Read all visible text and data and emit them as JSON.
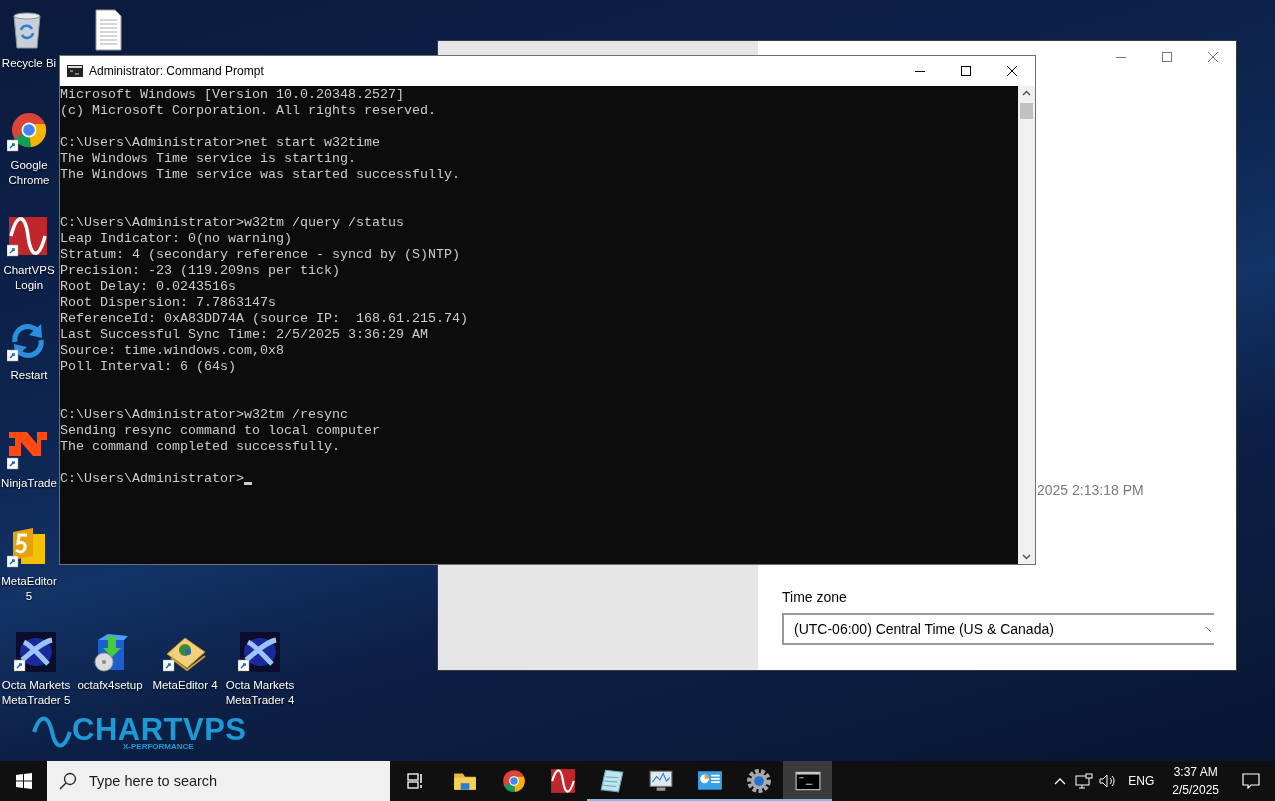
{
  "desktop": {
    "icons": [
      {
        "kind": "recycle-bin",
        "label": "Recycle Bi"
      },
      {
        "kind": "document"
      },
      {
        "kind": "chrome",
        "label": "Google Chrome"
      },
      {
        "kind": "chartvps",
        "label": "ChartVPS Login"
      },
      {
        "kind": "restart",
        "label": "Restart"
      },
      {
        "kind": "ninja",
        "label": "NinjaTrade"
      },
      {
        "kind": "metaeditor5",
        "label": "MetaEditor 5"
      },
      {
        "kind": "octa",
        "label": "Octa Markets MetaTrader 5"
      },
      {
        "kind": "setup",
        "label": "octafx4setup"
      },
      {
        "kind": "metaeditor4",
        "label": "MetaEditor 4"
      },
      {
        "kind": "octa",
        "label": "Octa Markets MetaTrader 4"
      }
    ],
    "wallpaper_logo": {
      "title": "CHARTVPS",
      "subtitle": "X-PERFORMANCE"
    }
  },
  "settings_window": {
    "time_text": "2025 2:13:18 PM",
    "time_zone_label": "Time zone",
    "time_zone_value": "(UTC-06:00) Central Time (US & Canada)"
  },
  "command_prompt": {
    "title": "Administrator: Command Prompt",
    "blocks": [
      [
        "Microsoft Windows [Version 10.0.20348.2527]",
        "(c) Microsoft Corporation. All rights reserved."
      ],
      [
        "C:\\Users\\Administrator>net start w32time",
        "The Windows Time service is starting.",
        "The Windows Time service was started successfully."
      ],
      [
        "C:\\Users\\Administrator>w32tm /query /status",
        "Leap Indicator: 0(no warning)",
        "Stratum: 4 (secondary reference - syncd by (S)NTP)",
        "Precision: -23 (119.209ns per tick)",
        "Root Delay: 0.0243516s",
        "Root Dispersion: 7.7863147s",
        "ReferenceId: 0xA83DD74A (source IP:  168.61.215.74)",
        "Last Successful Sync Time: 2/5/2025 3:36:29 AM",
        "Source: time.windows.com,0x8",
        "Poll Interval: 6 (64s)"
      ],
      [
        "C:\\Users\\Administrator>w32tm /resync",
        "Sending resync command to local computer",
        "The command completed successfully."
      ],
      [
        "C:\\Users\\Administrator>"
      ]
    ]
  },
  "taskbar": {
    "search": {
      "placeholder": "Type here to search"
    },
    "apps": [
      {
        "kind": "file-explorer",
        "running": false,
        "active": false
      },
      {
        "kind": "chrome",
        "running": false,
        "active": false
      },
      {
        "kind": "chartvps",
        "running": false,
        "active": false
      },
      {
        "kind": "notepad",
        "running": true,
        "active": false
      },
      {
        "kind": "monitor",
        "running": true,
        "active": false
      },
      {
        "kind": "control-panel",
        "running": true,
        "active": false
      },
      {
        "kind": "settings",
        "running": true,
        "active": false
      },
      {
        "kind": "command-prompt",
        "running": true,
        "active": true
      }
    ],
    "tray": {
      "language": "ENG",
      "time": "3:37 AM",
      "date": "2/5/2025"
    }
  }
}
